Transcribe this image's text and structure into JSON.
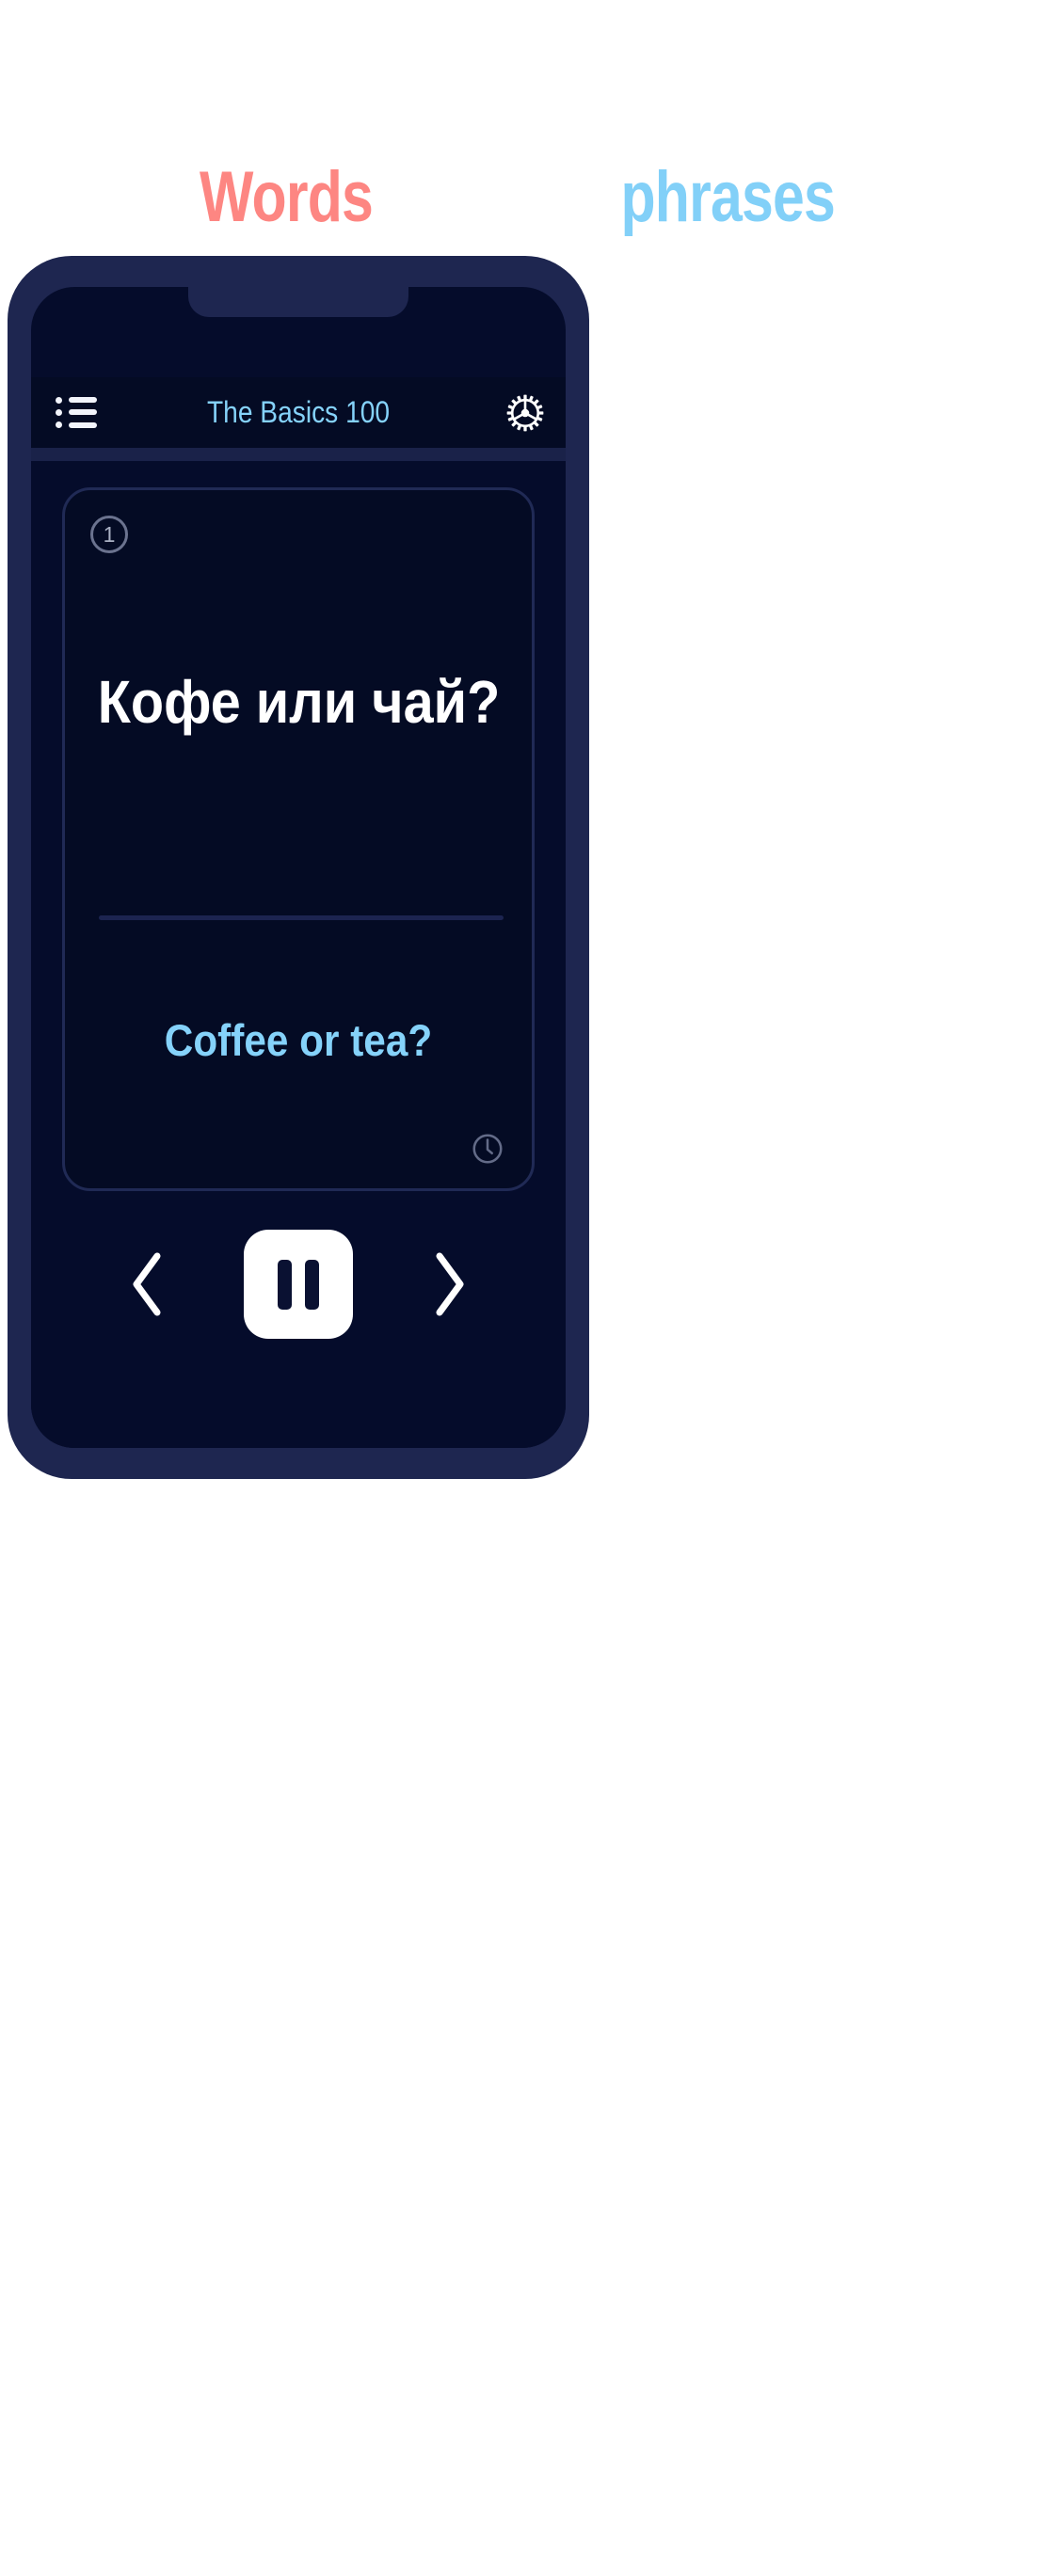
{
  "brand": {
    "words_label": "Words",
    "phrases_label": "phrases",
    "words_color": "#fd8682",
    "phrases_color": "#82d0f8"
  },
  "phone": {
    "frame_color": "#1e2650",
    "screen_color": "#050c2b"
  },
  "appbar": {
    "menu_icon": "list-icon",
    "title": "The Basics 100",
    "title_color": "#85d2fa",
    "settings_icon": "gear-icon"
  },
  "card": {
    "index": "1",
    "term": "Кофе или чай?",
    "term_color": "#ffffff",
    "translation": "Coffee or tea?",
    "translation_color": "#85d2fa",
    "timer_icon": "clock-icon"
  },
  "controls": {
    "previous_icon": "chevron-left-icon",
    "play_state_icon": "pause-icon",
    "next_icon": "chevron-right-icon",
    "button_color": "#ffffff"
  }
}
